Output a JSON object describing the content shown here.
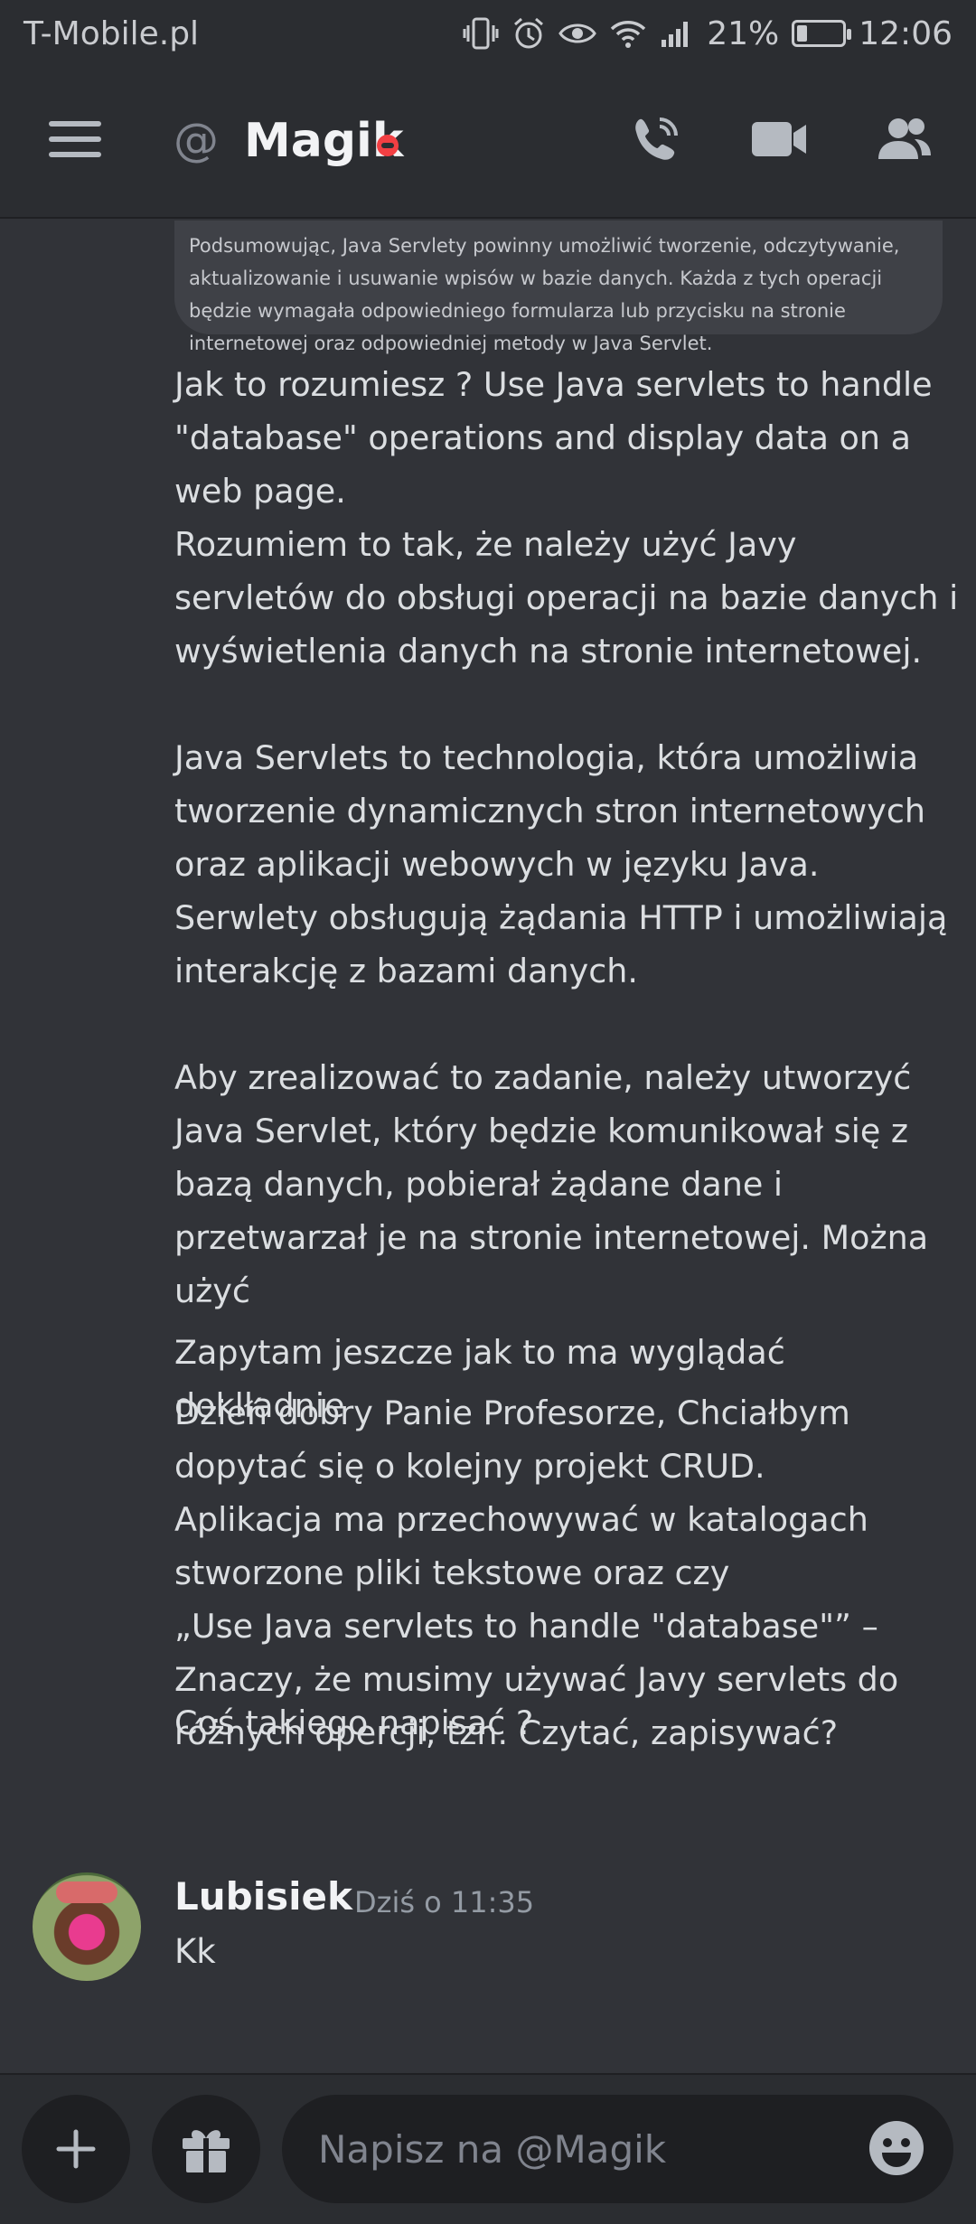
{
  "statusbar": {
    "carrier": "T-Mobile.pl",
    "battery_percent": "21%",
    "battery_level": 0.21,
    "time": "12:06",
    "icons": [
      "vibrate-icon",
      "alarm-icon",
      "eye-icon",
      "wifi-icon",
      "signal-icon",
      "battery-icon"
    ]
  },
  "header": {
    "at_symbol": "@",
    "channel_name": "Magik",
    "status": "do-not-disturb",
    "status_color": "#f23f43"
  },
  "messages": {
    "embed_text": "Podsumowując, Java Servlety powinny umożliwić tworzenie, odczytywanie, aktualizowanie i usuwanie wpisów w bazie danych. Każda z tych operacji będzie wymagała odpowiedniego formularza lub przycisku na stronie internetowej oraz odpowiedniej metody w Java Servlet.",
    "block1": "Jak to rozumiesz ? Use Java servlets to handle \"database\" operations and display data on a web page.\nRozumiem to tak, że należy użyć Javy servletów do obsługi operacji na bazie danych i wyświetlenia danych na stronie internetowej.\n\nJava Servlets to technologia, która umożliwia tworzenie dynamicznych stron internetowych oraz aplikacji webowych w języku Java. Serwlety obsługują żądania HTTP i umożliwiają interakcję z bazami danych.\n\nAby zrealizować to zadanie, należy utworzyć Java Servlet, który będzie komunikował się z bazą danych, pobierał żądane dane i przetwarzał je na stronie internetowej. Można użyć",
    "block2": "Zapytam jeszcze jak to ma wyglądać doklładnie",
    "block3": "Dzień dobry Panie Profesorze, Chciałbym dopytać się o kolejny projekt CRUD.\nAplikacja ma przechowywać w katalogach stworzone pliki tekstowe oraz czy\n„Use Java servlets to handle \"database\"” – Znaczy, że musimy używać Javy servlets do różnych opercji, tzn. Czytać, zapisywać?",
    "block4": "Coś takiego napisać ?",
    "reply_author": "Lubisiek",
    "reply_time": "Dziś o 11:35",
    "reply_text": "Kk"
  },
  "composer": {
    "placeholder": "Napisz na @Magik",
    "add_icon": "plus-icon",
    "gift_icon": "gift-icon",
    "emoji_icon": "emoji-icon"
  },
  "colors": {
    "background": "#313338",
    "bars": "#2b2d31",
    "input": "#1e1f22"
  }
}
